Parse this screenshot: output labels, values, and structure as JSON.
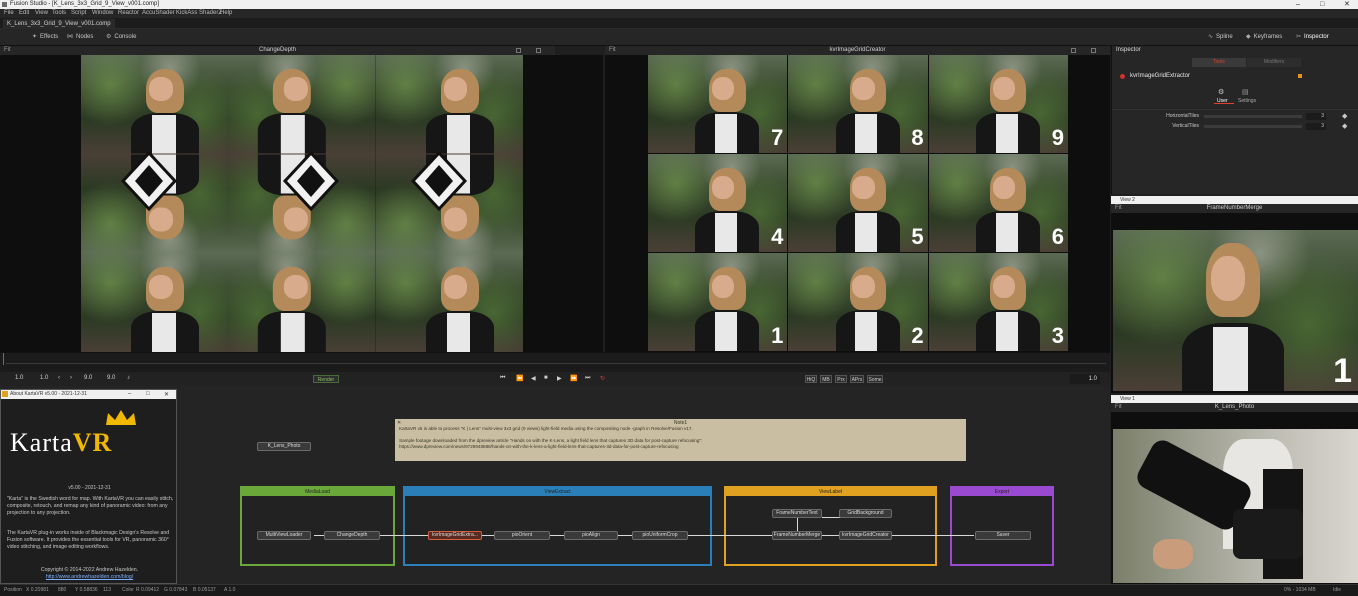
{
  "window": {
    "title": "Fusion Studio - [K_Lens_3x3_Grid_9_View_v001.comp]",
    "controls": [
      "–",
      "□",
      "✕"
    ]
  },
  "menu": [
    "File",
    "Edit",
    "View",
    "Tools",
    "Script",
    "Window",
    "Reactor",
    "AccuShader",
    "KickAss ShaderZ",
    "Help"
  ],
  "tab": {
    "label": "K_Lens_3x3_Grid_9_View_v001.comp"
  },
  "toolbar": {
    "effects": "Effects",
    "nodes": "Nodes",
    "console": "Console",
    "spline": "Spline",
    "keyframes": "Keyframes",
    "inspector": "Inspector"
  },
  "viewers": {
    "left": {
      "name": "ChangeDepth",
      "fit": "Fit"
    },
    "right": {
      "name": "kvrImageGridCreator",
      "fit": "Fit"
    },
    "tile_numbers": [
      "7",
      "8",
      "9",
      "4",
      "5",
      "6",
      "1",
      "2",
      "3"
    ]
  },
  "inspector": {
    "title": "Inspector",
    "tab_tools": "Tools",
    "tab_modifiers": "Modifiers",
    "node_name": "kvrImageGridExtractor",
    "sub_user": "User",
    "sub_settings": "Settings",
    "params": [
      {
        "label": "HorizontalTiles",
        "value": "3"
      },
      {
        "label": "VerticalTiles",
        "value": "3"
      }
    ]
  },
  "view2": {
    "window": "View 2",
    "fit": "Fit",
    "name": "FrameNumberMerge",
    "tile_number": "1"
  },
  "view1": {
    "window": "View 1",
    "fit": "Fit",
    "name": "K_Lens_Photo"
  },
  "transport": {
    "start": "1.0",
    "current_start": "1.0",
    "end": "9.0",
    "end2": "9.0",
    "render": "Render",
    "quality": [
      "HiQ",
      "MB",
      "Prx",
      "APrx",
      "Some"
    ],
    "frame": "1.0"
  },
  "about": {
    "title": "About KartaVR v5.00 - 2021-12-31",
    "logo_a": "Karta",
    "logo_b": "VR",
    "version": "v5.00 - 2021-12-31",
    "para1": "\"Karta\" is the Swedish word for map. With KartaVR you can easily stitch, composite, retouch, and remap any kind of panoramic video: from any projection to any projection.",
    "para2": "The KartaVR plug-in works inside of Blackmagic Design's Resolve and Fusion software. It provides the essential tools for VR, panoramic 360° video stitching, and image editing workflows.",
    "copyright": "Copyright © 2014-2022 Andrew Hazelden.",
    "link": "http://www.andrewhazelden.com/blog/"
  },
  "note": {
    "title": "Note1",
    "line1": "KartaVR v5 is able to process \"K | Lens\" multi-view 3x3 grid (9 views) light-field media using the compositing node -graph in Resolve/Fusion v17.",
    "line2": "Sample footage downloaded from the dpreview article \"Hands on with the K-Lens, a light field lens that captures 3D data for post-capture refocusing\":",
    "line3": "https://www.dpreview.com/news/9729848888/hands-on-with-the-k-lens-a-light-field-lens-that-captures-3d-data-for-post-capture-refocusing"
  },
  "groups": {
    "mediaload": "MediaLoad",
    "viewextract": "ViewExtract",
    "viewlabel": "ViewLabel",
    "export": "Export",
    "colors": {
      "mediaload": "#6aa83a",
      "viewextract": "#2a7fb8",
      "viewlabel": "#e0a020",
      "export": "#9a4ad0"
    }
  },
  "nodes": {
    "photo": "K_Lens_Photo",
    "loader": "MultiViewLoader",
    "changedepth": "ChangeDepth",
    "extractor": "kvrImageGridExtra...",
    "orient": "pioOrient",
    "align": "pioAlign",
    "crop": "pioUniformCrop",
    "fntext": "FrameNumberText",
    "gridbg": "GridBackground",
    "fnmerge": "FrameNumberMerge",
    "gridcreator": "kvrImageGridCreator",
    "saver": "Saver"
  },
  "status": {
    "position": "Position",
    "x": "X 0.20981",
    "xpx": "880",
    "y": "Y 0.58836",
    "ypx": "113",
    "color": "Color",
    "r": "R 0.09412",
    "g": "G 0.07843",
    "b": "B 0.05137",
    "a": "A 1.0",
    "memory": "0% - 1034 MB",
    "state": "Idle"
  }
}
